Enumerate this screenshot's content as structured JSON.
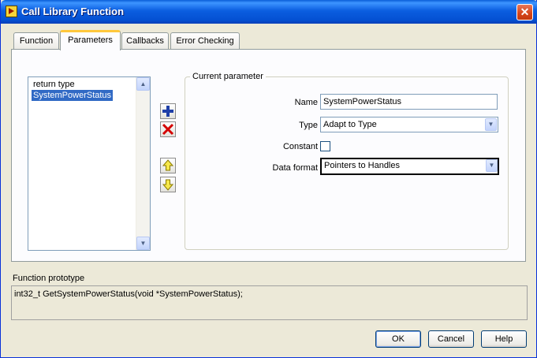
{
  "window": {
    "title": "Call Library Function",
    "close_label": "✕"
  },
  "tabs": [
    {
      "label": "Function"
    },
    {
      "label": "Parameters",
      "active": true
    },
    {
      "label": "Callbacks"
    },
    {
      "label": "Error Checking"
    }
  ],
  "parameters": {
    "items": [
      {
        "label": "return type"
      },
      {
        "label": "SystemPowerStatus",
        "selected": true
      }
    ]
  },
  "toolbar": {
    "add_icon": "plus-icon",
    "delete_icon": "x-icon",
    "up_icon": "arrow-up-icon",
    "down_icon": "arrow-down-icon"
  },
  "current_parameter": {
    "legend": "Current parameter",
    "name_label": "Name",
    "name_value": "SystemPowerStatus",
    "type_label": "Type",
    "type_value": "Adapt to Type",
    "constant_label": "Constant",
    "constant_checked": false,
    "data_format_label": "Data format",
    "data_format_value": "Pointers to Handles"
  },
  "prototype": {
    "label": "Function prototype",
    "value": "int32_t GetSystemPowerStatus(void *SystemPowerStatus);"
  },
  "buttons": {
    "ok": "OK",
    "cancel": "Cancel",
    "help": "Help"
  },
  "colors": {
    "titlebar": "#0054e3",
    "selection": "#316ac5",
    "add": "#1f3fa8",
    "delete": "#d40000",
    "arrows": "#c9b300"
  }
}
